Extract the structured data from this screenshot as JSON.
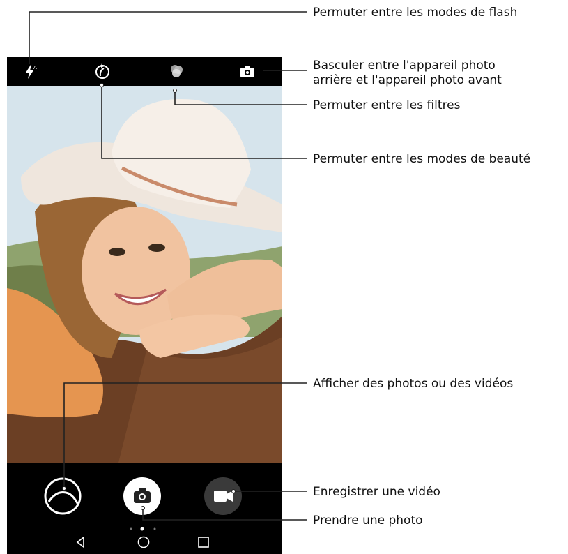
{
  "callouts": {
    "flash": "Permuter entre les modes de flash",
    "switch_camera_line1": "Basculer entre l'appareil photo",
    "switch_camera_line2": "arrière et l'appareil photo avant",
    "filters": "Permuter entre les filtres",
    "beauty": "Permuter entre les modes de beauté",
    "gallery": "Afficher des photos ou des vidéos",
    "record": "Enregistrer une vidéo",
    "shutter": "Prendre une photo"
  },
  "icons": {
    "flash": "flash-auto-icon",
    "beauty": "beauty-mode-icon",
    "filters": "filters-icon",
    "switch_camera": "switch-camera-icon",
    "gallery": "gallery-icon",
    "shutter": "camera-shutter-icon",
    "video": "video-record-icon",
    "back": "nav-back-icon",
    "home": "nav-home-icon",
    "recents": "nav-recents-icon"
  },
  "viewfinder": {
    "subject": "smiling girl in white cowboy hat resting on horse"
  },
  "colors": {
    "line": "#222222",
    "bar": "#000000",
    "shutter_bg": "#ffffff",
    "video_bg": "#3a3a3a"
  }
}
